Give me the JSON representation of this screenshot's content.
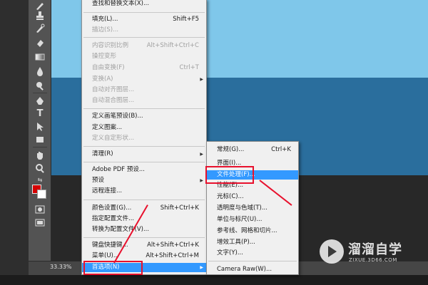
{
  "status": {
    "zoom": "33.33%"
  },
  "main_menu": {
    "items": [
      {
        "label": "查找和替换文本(X)...",
        "shortcut": "",
        "disabled": false
      },
      {
        "label": "填充(L)...",
        "shortcut": "Shift+F5",
        "disabled": false
      },
      {
        "label": "描边(S)...",
        "shortcut": "",
        "disabled": true
      },
      {
        "label": "内容识别比例",
        "shortcut": "Alt+Shift+Ctrl+C",
        "disabled": true
      },
      {
        "label": "操控变形",
        "shortcut": "",
        "disabled": true
      },
      {
        "label": "自由变换(F)",
        "shortcut": "Ctrl+T",
        "disabled": true
      },
      {
        "label": "变换(A)",
        "shortcut": "",
        "disabled": true
      },
      {
        "label": "自动对齐图层...",
        "shortcut": "",
        "disabled": true
      },
      {
        "label": "自动混合图层...",
        "shortcut": "",
        "disabled": true
      },
      {
        "label": "定义画笔预设(B)...",
        "shortcut": "",
        "disabled": false
      },
      {
        "label": "定义图案...",
        "shortcut": "",
        "disabled": false
      },
      {
        "label": "定义自定形状...",
        "shortcut": "",
        "disabled": true
      },
      {
        "label": "清理(R)",
        "shortcut": "",
        "disabled": false
      },
      {
        "label": "Adobe PDF 预设...",
        "shortcut": "",
        "disabled": false
      },
      {
        "label": "预设",
        "shortcut": "",
        "disabled": false
      },
      {
        "label": "远程连接...",
        "shortcut": "",
        "disabled": false
      },
      {
        "label": "颜色设置(G)...",
        "shortcut": "Shift+Ctrl+K",
        "disabled": false
      },
      {
        "label": "指定配置文件...",
        "shortcut": "",
        "disabled": false
      },
      {
        "label": "转换为配置文件(V)...",
        "shortcut": "",
        "disabled": false
      },
      {
        "label": "键盘快捷键...",
        "shortcut": "Alt+Shift+Ctrl+K",
        "disabled": false
      },
      {
        "label": "菜单(U)...",
        "shortcut": "Alt+Shift+Ctrl+M",
        "disabled": false
      },
      {
        "label": "首选项(N)",
        "shortcut": "",
        "disabled": false
      }
    ]
  },
  "sub_menu": {
    "items": [
      {
        "label": "常规(G)...",
        "shortcut": "Ctrl+K"
      },
      {
        "label": "界面(I)...",
        "shortcut": ""
      },
      {
        "label": "文件处理(F)...",
        "shortcut": ""
      },
      {
        "label": "性能(E)...",
        "shortcut": ""
      },
      {
        "label": "光标(C)...",
        "shortcut": ""
      },
      {
        "label": "透明度与色域(T)...",
        "shortcut": ""
      },
      {
        "label": "单位与标尺(U)...",
        "shortcut": ""
      },
      {
        "label": "参考线、网格和切片...",
        "shortcut": ""
      },
      {
        "label": "增效工具(P)...",
        "shortcut": ""
      },
      {
        "label": "文字(Y)...",
        "shortcut": ""
      },
      {
        "label": "Camera Raw(W)...",
        "shortcut": ""
      }
    ]
  },
  "watermark": {
    "title": "溜溜自学",
    "url": "ZIXUE.3D66.COM"
  },
  "tools": [
    "brush-icon",
    "stamp-icon",
    "history-brush-icon",
    "eraser-icon",
    "gradient-icon",
    "blur-icon",
    "dodge-icon",
    "pen-icon",
    "type-icon",
    "path-select-icon",
    "shape-icon",
    "hand-icon",
    "zoom-icon",
    "quick-mask-icon",
    "screen-mode-icon"
  ],
  "colors": {
    "highlight": "#3399ff",
    "annotation": "#e8112d",
    "foreground": "#d40000",
    "background": "#ffffff"
  }
}
